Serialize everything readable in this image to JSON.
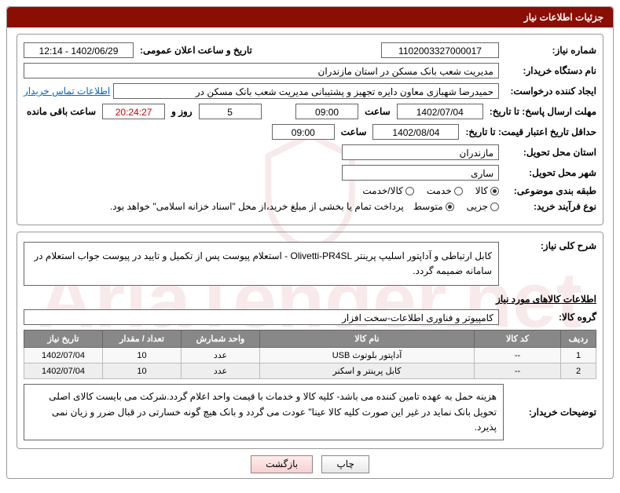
{
  "header_title": "جزئیات اطلاعات نیاز",
  "labels": {
    "need_no": "شماره نیاز:",
    "announce_dt": "تاریخ و ساعت اعلان عمومی:",
    "buyer_org": "نام دستگاه خریدار:",
    "requester": "ایجاد کننده درخواست:",
    "contact_link": "اطلاعات تماس خریدار",
    "deadline_reply": "مهلت ارسال پاسخ: تا تاریخ:",
    "hour": "ساعت",
    "days_and": "روز و",
    "remaining": "ساعت باقی مانده",
    "min_validity": "حداقل تاریخ اعتبار قیمت: تا تاریخ:",
    "delivery_province": "استان محل تحویل:",
    "delivery_city": "شهر محل تحویل:",
    "subject_class": "طبقه بندی موضوعی:",
    "r_goods": "کالا",
    "r_service": "خدمت",
    "r_goods_service": "کالا/خدمت",
    "purchase_type": "نوع فرآیند خرید:",
    "r_small": "جزیی",
    "r_medium": "متوسط",
    "treasury_note": "پرداخت تمام یا بخشی از مبلغ خرید،از محل \"اسناد خزانه اسلامی\" خواهد بود.",
    "overall_desc": "شرح کلی نیاز:",
    "goods_info": "اطلاعات کالاهای مورد نیاز",
    "goods_group": "گروه کالا:",
    "buyer_notes": "توضیحات خریدار:",
    "btn_print": "چاپ",
    "btn_back": "بازگشت"
  },
  "fields": {
    "need_no": "1102003327000017",
    "announce_dt": "1402/06/29 - 12:14",
    "buyer_org": "مدیریت شعب بانک مسکن در استان مازندران",
    "requester": "حمیدرضا شهبازی معاون دایره تجهیز و پشتیبانی  مدیریت شعب بانک مسکن در",
    "deadline_date": "1402/07/04",
    "deadline_time": "09:00",
    "days_left": "5",
    "time_left": "20:24:27",
    "validity_date": "1402/08/04",
    "validity_time": "09:00",
    "province": "مازندران",
    "city": "ساری",
    "overall_desc": "کابل ارتباطی و آداپتور اسلیپ پرینتر Olivetti-PR4SL - استعلام پیوست پس از تکمیل و تایید در پیوست جواب استعلام در سامانه ضمیمه گردد.",
    "goods_group": "کامپیوتر و فناوری اطلاعات-سخت افزار",
    "buyer_notes": "هزینه حمل به عهده تامین کننده می باشد- کلیه کالا و خدمات با قیمت واحد اعلام گردد.شرکت می بایست کالای اصلی تحویل بانک نماید در غیر این صورت کلیه کالا عینا\" عودت می گردد و بانک هیچ گونه  خسارتی در قبال ضرر و زیان  نمی پذیرد."
  },
  "cols": {
    "row": "ردیف",
    "code": "کد کالا",
    "name": "نام کالا",
    "unit": "واحد شمارش",
    "qty": "تعداد / مقدار",
    "date": "تاریخ نیاز"
  },
  "items": [
    {
      "row": "1",
      "code": "--",
      "name": "آداپتور بلوتوث USB",
      "unit": "عدد",
      "qty": "10",
      "date": "1402/07/04"
    },
    {
      "row": "2",
      "code": "--",
      "name": "کابل پرینتر و اسکنر",
      "unit": "عدد",
      "qty": "10",
      "date": "1402/07/04"
    }
  ],
  "chart_data": {
    "type": "table",
    "columns": [
      "ردیف",
      "کد کالا",
      "نام کالا",
      "واحد شمارش",
      "تعداد / مقدار",
      "تاریخ نیاز"
    ],
    "rows": [
      [
        "1",
        "--",
        "آداپتور بلوتوث USB",
        "عدد",
        "10",
        "1402/07/04"
      ],
      [
        "2",
        "--",
        "کابل پرینتر و اسکنر",
        "عدد",
        "10",
        "1402/07/04"
      ]
    ]
  }
}
